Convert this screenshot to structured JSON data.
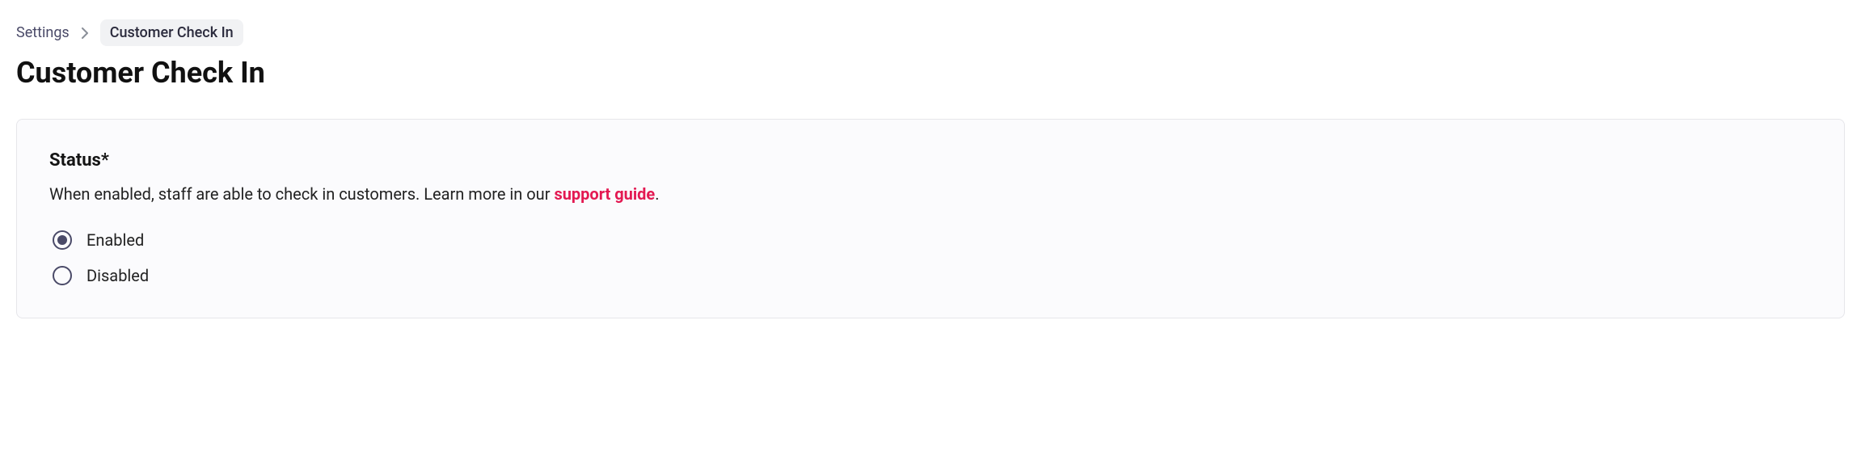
{
  "breadcrumb": {
    "root": "Settings",
    "current": "Customer Check In"
  },
  "page": {
    "title": "Customer Check In"
  },
  "status": {
    "heading": "Status*",
    "description_prefix": "When enabled, staff are able to check in customers. Learn more in our ",
    "link_text": "support guide",
    "description_suffix": ".",
    "options": {
      "enabled": "Enabled",
      "disabled": "Disabled"
    },
    "selected": "enabled"
  }
}
